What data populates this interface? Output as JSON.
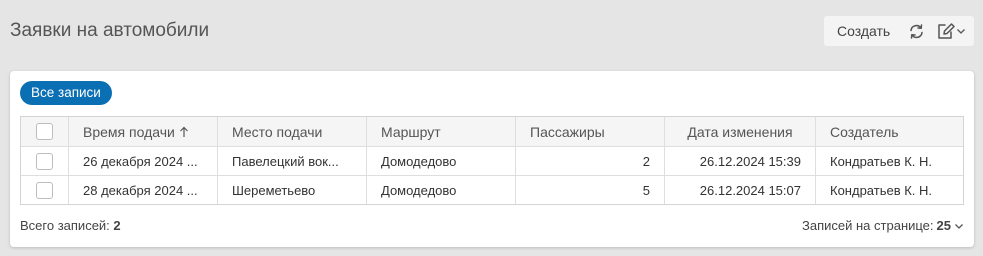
{
  "header": {
    "title": "Заявки на автомобили",
    "create_label": "Создать"
  },
  "filter": {
    "chip_label": "Все записи"
  },
  "table": {
    "columns": [
      "Время подачи",
      "Место подачи",
      "Маршрут",
      "Пассажиры",
      "Дата изменения",
      "Создатель"
    ],
    "sort_icon": "arrow-up-icon",
    "rows": [
      {
        "time": "26 декабря 2024 ...",
        "place": "Павелецкий вок...",
        "route": "Домодедово",
        "passengers": "2",
        "modified": "26.12.2024 15:39",
        "creator": "Кондратьев К. Н."
      },
      {
        "time": "28 декабря 2024 ...",
        "place": "Шереметьево",
        "route": "Домодедово",
        "passengers": "5",
        "modified": "26.12.2024 15:07",
        "creator": "Кондратьев К. Н."
      }
    ]
  },
  "footer": {
    "total_label": "Всего записей:",
    "total_value": "2",
    "per_page_label": "Записей на странице:",
    "per_page_value": "25"
  },
  "colors": {
    "accent": "#0b6fb3",
    "background": "#e5e5e5"
  }
}
